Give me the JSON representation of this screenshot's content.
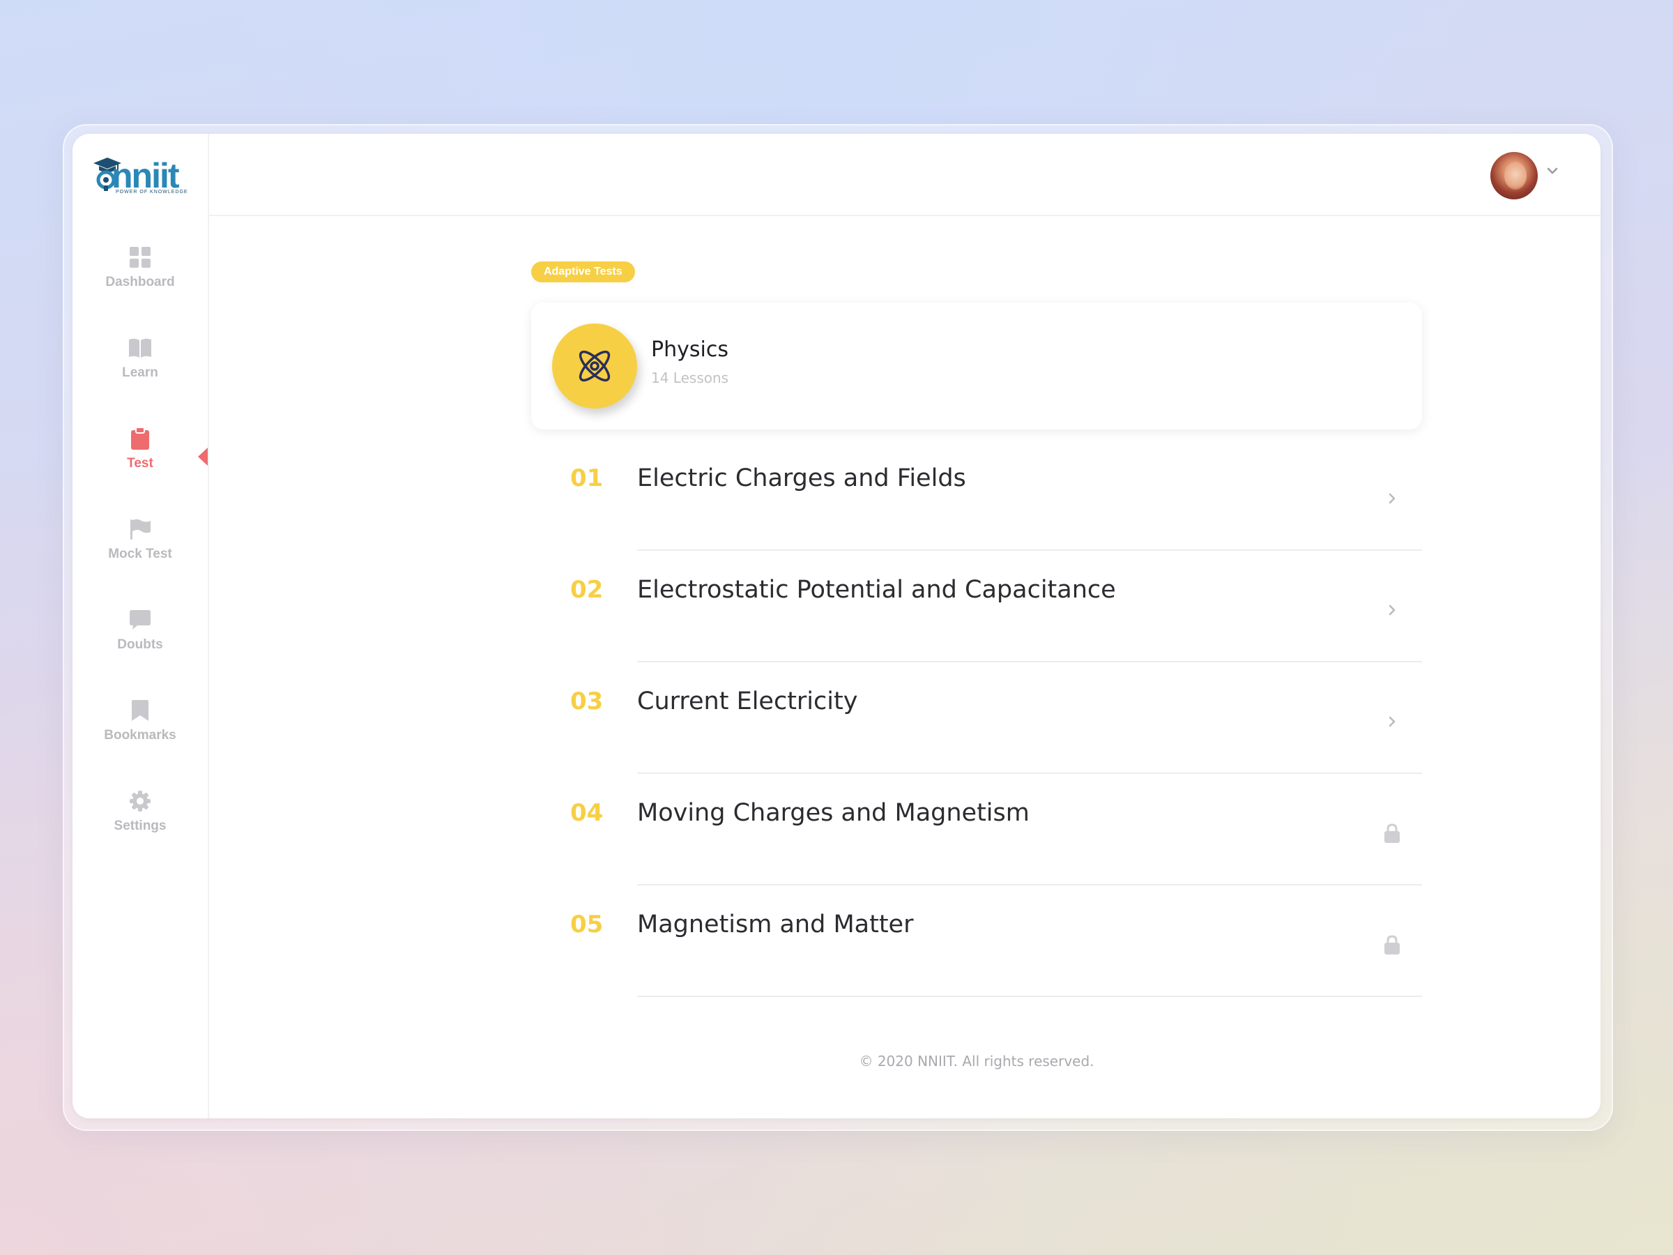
{
  "brand": {
    "logo_text": "nniit",
    "tagline": "POWER OF KNOWLEDGE"
  },
  "sidebar": {
    "items": [
      {
        "label": "Dashboard",
        "icon": "dashboard-icon"
      },
      {
        "label": "Learn",
        "icon": "book-icon"
      },
      {
        "label": "Test",
        "icon": "clipboard-icon",
        "active": true
      },
      {
        "label": "Mock Test",
        "icon": "flag-icon"
      },
      {
        "label": "Doubts",
        "icon": "chat-bubble-icon"
      },
      {
        "label": "Bookmarks",
        "icon": "bookmark-icon"
      },
      {
        "label": "Settings",
        "icon": "gear-icon"
      }
    ]
  },
  "main": {
    "badge": "Adaptive Tests",
    "subject": {
      "name": "Physics",
      "lessons": "14 Lessons",
      "icon": "atom-icon"
    },
    "chapters": [
      {
        "number": "01",
        "title": "Electric Charges and Fields",
        "status": "open"
      },
      {
        "number": "02",
        "title": "Electrostatic Potential and Capacitance",
        "status": "open"
      },
      {
        "number": "03",
        "title": "Current Electricity",
        "status": "open"
      },
      {
        "number": "04",
        "title": "Moving Charges and Magnetism",
        "status": "locked"
      },
      {
        "number": "05",
        "title": "Magnetism and Matter",
        "status": "locked"
      }
    ],
    "footer": "© 2020 NNIIT. All rights reserved."
  },
  "colors": {
    "accent_yellow": "#f7cf45",
    "active_red": "#ee6b6e",
    "muted_gray": "#b9b9be",
    "brand_blue": "#2b87b6"
  }
}
